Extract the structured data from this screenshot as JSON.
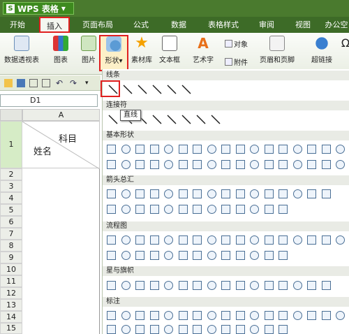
{
  "app": {
    "title": "WPS 表格"
  },
  "menu": {
    "items": [
      "开始",
      "插入",
      "页面布局",
      "公式",
      "数据",
      "表格样式",
      "审阅",
      "视图",
      "办公空"
    ],
    "active": "插入"
  },
  "ribbon": {
    "pivot": "数据透视表",
    "chart": "图表",
    "picture": "图片",
    "shapes": "形状",
    "shapes_arrow": "▾",
    "clipart": "素材库",
    "textbox": "文本框",
    "wordart": "艺术字",
    "object": "对象",
    "attachment": "附件",
    "header_footer": "页眉和页脚",
    "hyperlink": "超链接"
  },
  "namebox": {
    "value": "D1"
  },
  "sheet": {
    "column": "A",
    "cell_top": "科目",
    "cell_bottom": "姓名",
    "rows": [
      "1",
      "2",
      "3",
      "4",
      "5",
      "6",
      "7",
      "8",
      "9",
      "10",
      "11",
      "12",
      "13",
      "14",
      "15"
    ]
  },
  "panel": {
    "sections": [
      "线条",
      "连接符",
      "基本形状",
      "箭头总汇",
      "流程图",
      "星与旗帜",
      "标注"
    ]
  },
  "tooltip": {
    "text": "直线"
  }
}
